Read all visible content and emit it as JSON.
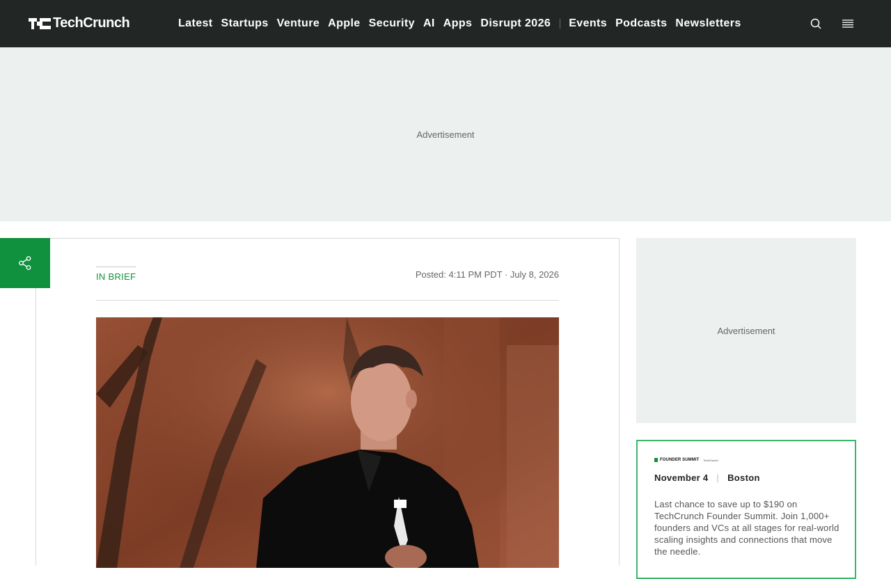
{
  "brand": {
    "logo_text": "TechCrunch",
    "accent": "#10913d",
    "header_bg": "#222726"
  },
  "nav": {
    "items": [
      "Latest",
      "Startups",
      "Venture",
      "Apple",
      "Security",
      "AI",
      "Apps",
      "Disrupt 2026"
    ],
    "secondary": [
      "Events",
      "Podcasts",
      "Newsletters"
    ]
  },
  "header_icons": [
    "search-icon",
    "menu-icon"
  ],
  "ads": {
    "top_label": "Advertisement",
    "side_label": "Advertisement"
  },
  "article": {
    "tag": "IN BRIEF",
    "posted": "Posted: 4:11 PM PDT · July 8, 2026"
  },
  "share": {
    "icon": "share-icon"
  },
  "promo": {
    "logo_text": "FOUNDER SUMMIT",
    "logo_sub": "TechCrunch",
    "date": "November 4",
    "location": "Boston",
    "body": "Last chance to save up to $190 on TechCrunch Founder Summit. Join 1,000+ founders and VCs at all stages for real-world scaling insights and connections that move the needle."
  }
}
